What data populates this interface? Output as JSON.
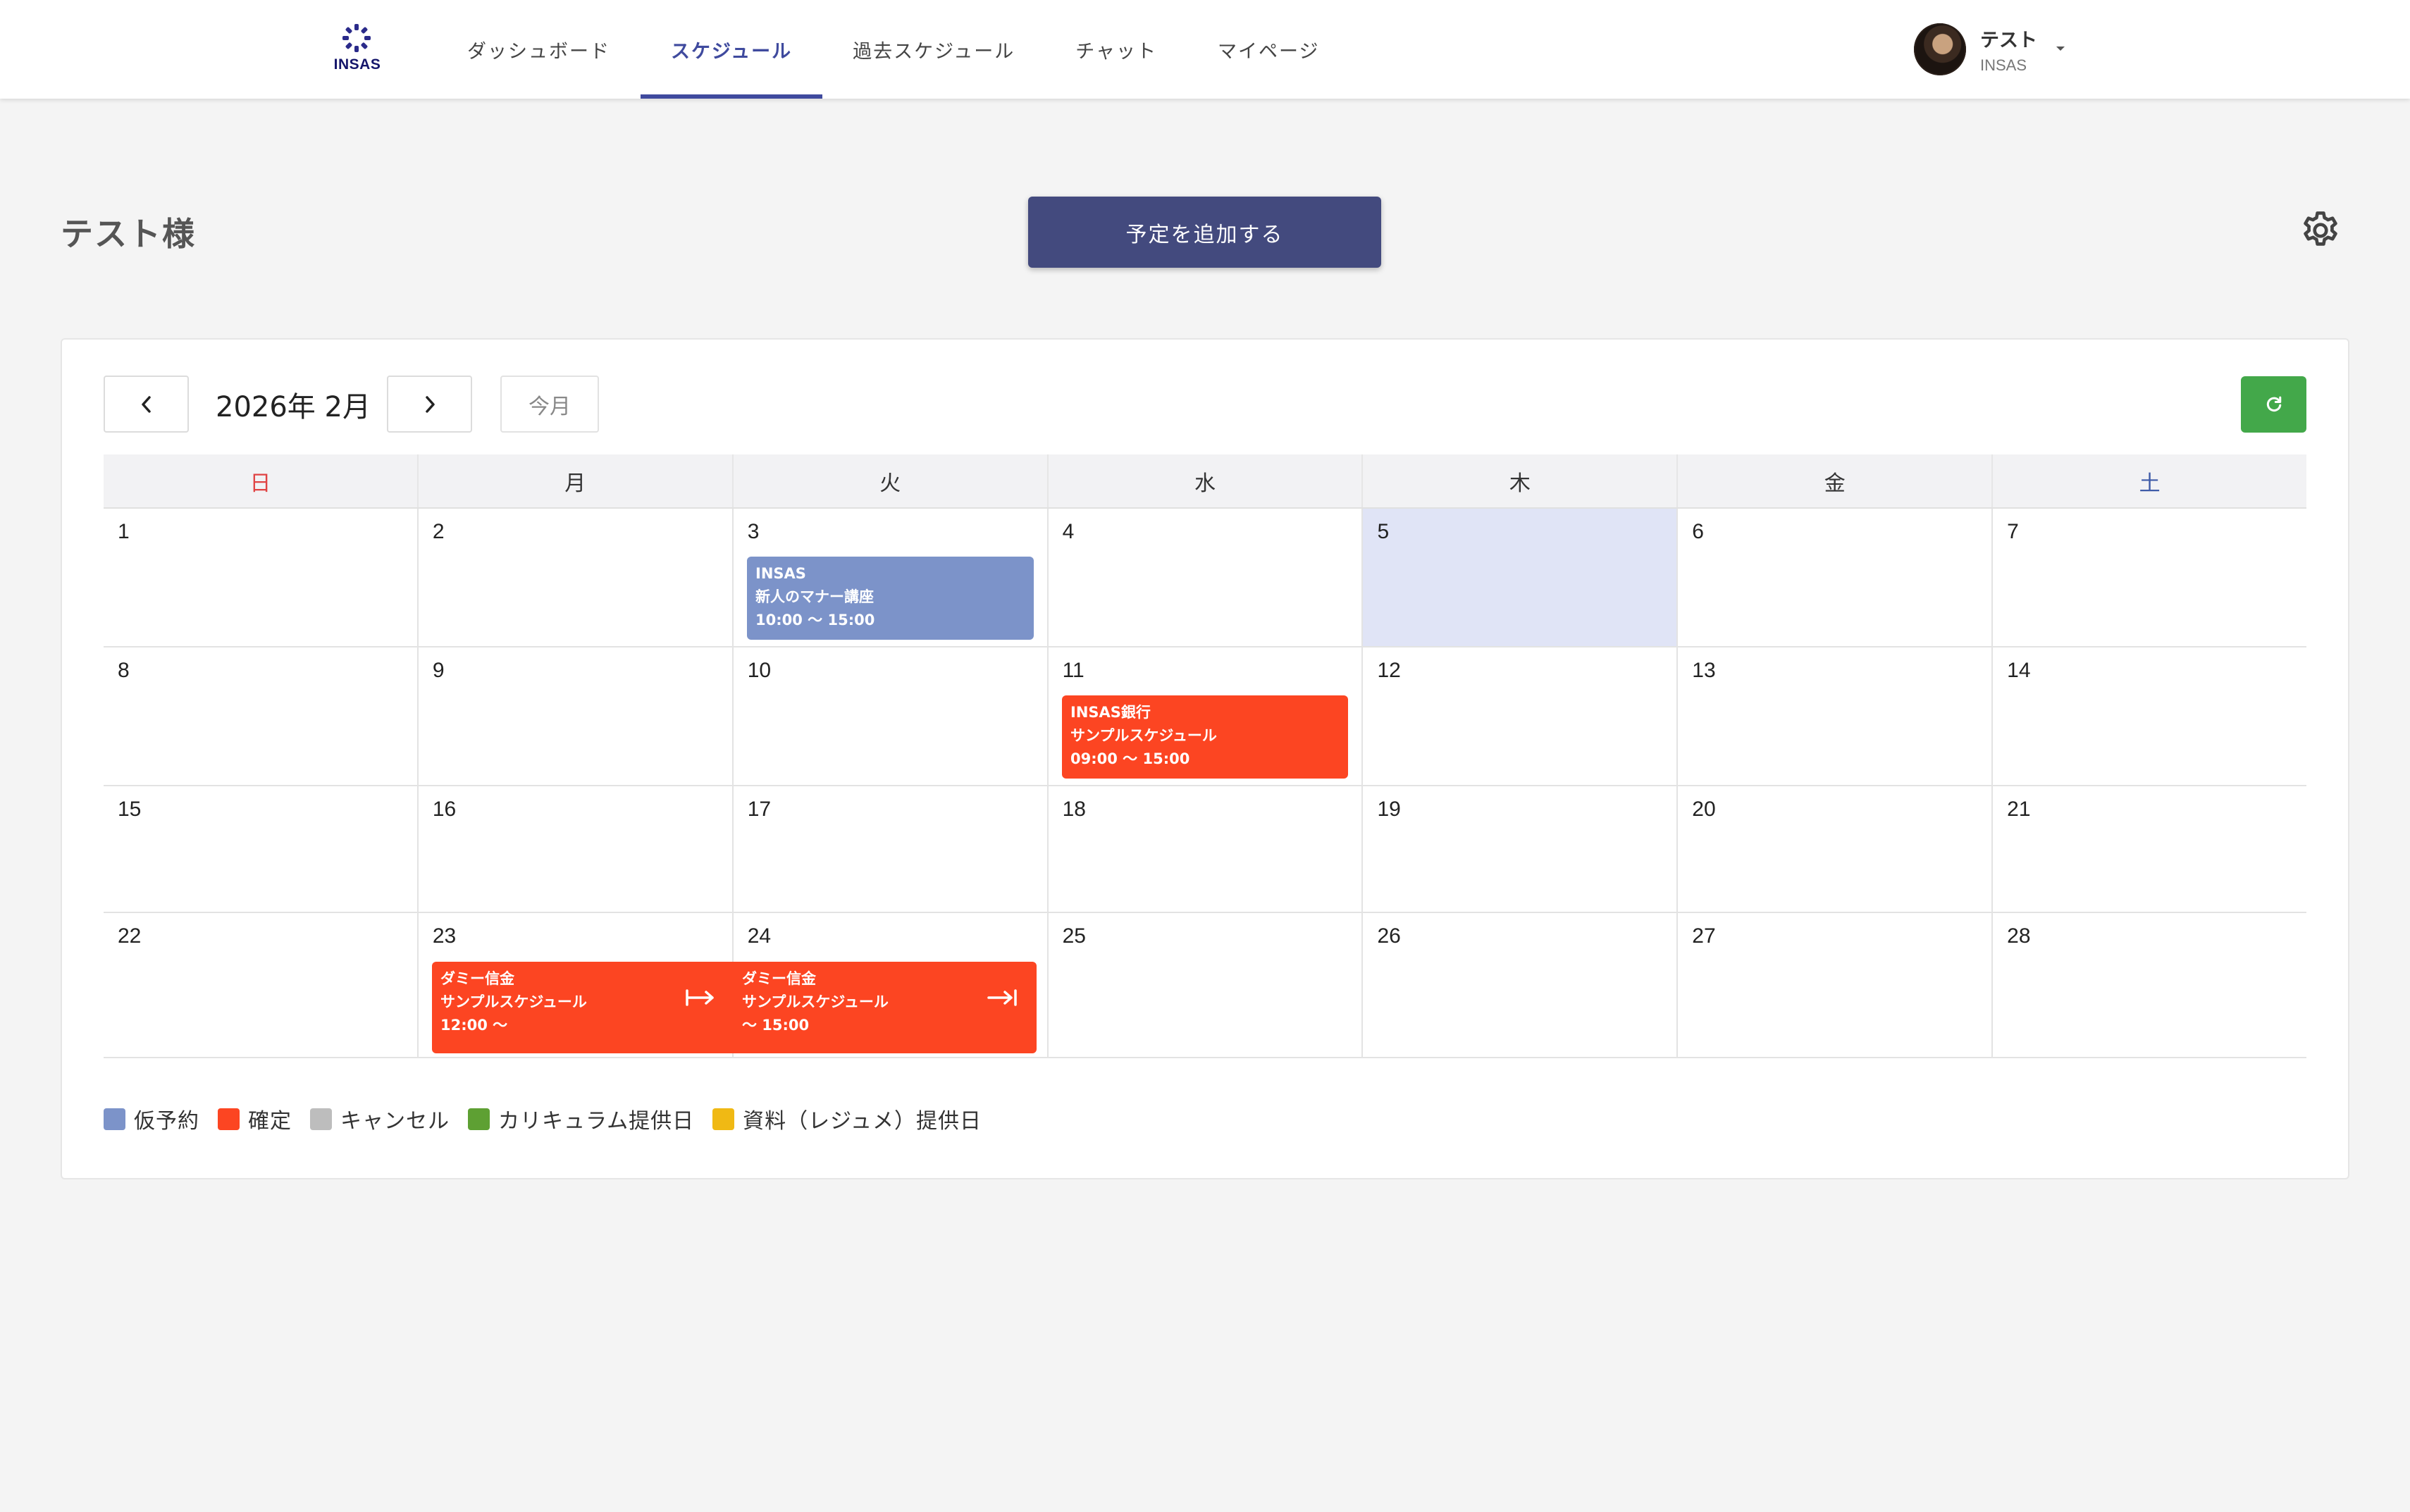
{
  "header": {
    "logo_text": "INSAS",
    "nav": [
      {
        "label": "ダッシュボード",
        "active": false
      },
      {
        "label": "スケジュール",
        "active": true
      },
      {
        "label": "過去スケジュール",
        "active": false
      },
      {
        "label": "チャット",
        "active": false
      },
      {
        "label": "マイページ",
        "active": false
      }
    ],
    "user": {
      "name": "テスト",
      "org": "INSAS"
    }
  },
  "page": {
    "title": "テスト様",
    "add_button_label": "予定を追加する"
  },
  "calendar": {
    "month_label": "2026年 2月",
    "today_label": "今月",
    "weekdays": [
      "日",
      "月",
      "火",
      "水",
      "木",
      "金",
      "土"
    ],
    "weeks": [
      [
        "1",
        "2",
        "3",
        "4",
        "5",
        "6",
        "7"
      ],
      [
        "8",
        "9",
        "10",
        "11",
        "12",
        "13",
        "14"
      ],
      [
        "15",
        "16",
        "17",
        "18",
        "19",
        "20",
        "21"
      ],
      [
        "22",
        "23",
        "24",
        "25",
        "26",
        "27",
        "28"
      ]
    ],
    "today": "5",
    "events": [
      {
        "company": "INSAS",
        "title": "新人のマナー講座",
        "time": "10:00 〜 15:00",
        "status": "仮予約",
        "date": "3"
      },
      {
        "company": "INSAS銀行",
        "title": "サンプルスケジュール",
        "time": "09:00 〜 15:00",
        "status": "確定",
        "date": "11"
      },
      {
        "company": "ダミー信金",
        "title": "サンプルスケジュール",
        "time": "12:00 〜",
        "status": "確定",
        "date": "23"
      },
      {
        "company": "ダミー信金",
        "title": "サンプルスケジュール",
        "time": "〜 15:00",
        "status": "確定",
        "date": "24"
      }
    ]
  },
  "legend": [
    {
      "label": "仮予約",
      "color": "#7c93c9"
    },
    {
      "label": "確定",
      "color": "#fc4522"
    },
    {
      "label": "キャンセル",
      "color": "#bdbdbd"
    },
    {
      "label": "カリキュラム提供日",
      "color": "#5ea033"
    },
    {
      "label": "資料（レジュメ）提供日",
      "color": "#f0b914"
    }
  ],
  "colors": {
    "accent": "#3f4a9e",
    "add_button": "#434a7e",
    "refresh_button": "#43a84a",
    "today_cell": "#e0e4f6"
  },
  "icons": [
    "insas-logo-icon",
    "chevron-left-icon",
    "chevron-right-icon",
    "refresh-icon",
    "gear-icon",
    "caret-down-icon",
    "arrow-continue-icon",
    "arrow-end-icon"
  ]
}
